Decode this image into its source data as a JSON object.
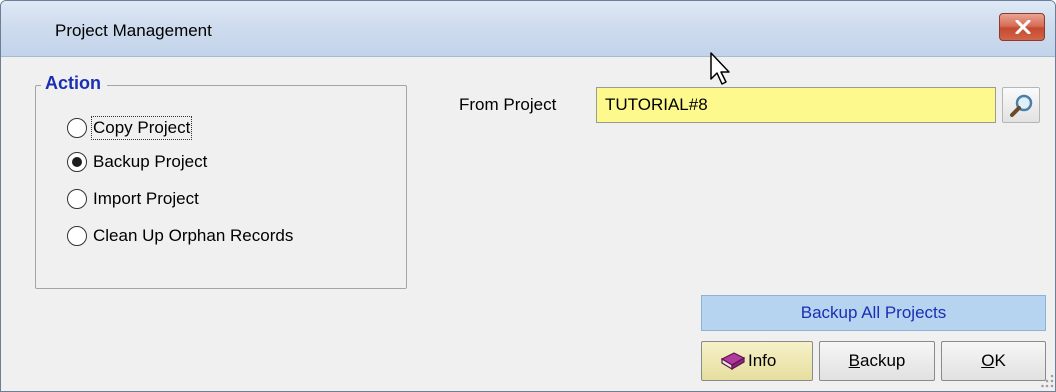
{
  "window": {
    "title": "Project Management"
  },
  "action_group": {
    "title": "Action",
    "options": [
      {
        "label": "Copy Project",
        "selected": false
      },
      {
        "label": "Backup Project",
        "selected": true
      },
      {
        "label": "Import Project",
        "selected": false
      },
      {
        "label": "Clean Up Orphan Records",
        "selected": false
      }
    ]
  },
  "from_project": {
    "label": "From Project",
    "value": "TUTORIAL#8",
    "field_color": "#fdf98c"
  },
  "buttons": {
    "backup_all": "Backup All Projects",
    "info": "Info",
    "backup_underlined": "B",
    "backup_rest": "ackup",
    "ok_underlined": "O",
    "ok_rest": "K"
  },
  "icons": {
    "close": "close-icon",
    "lookup": "magnifier-icon",
    "info": "book-icon",
    "cursor": "mouse-pointer-icon",
    "grip": "resize-grip-icon"
  }
}
